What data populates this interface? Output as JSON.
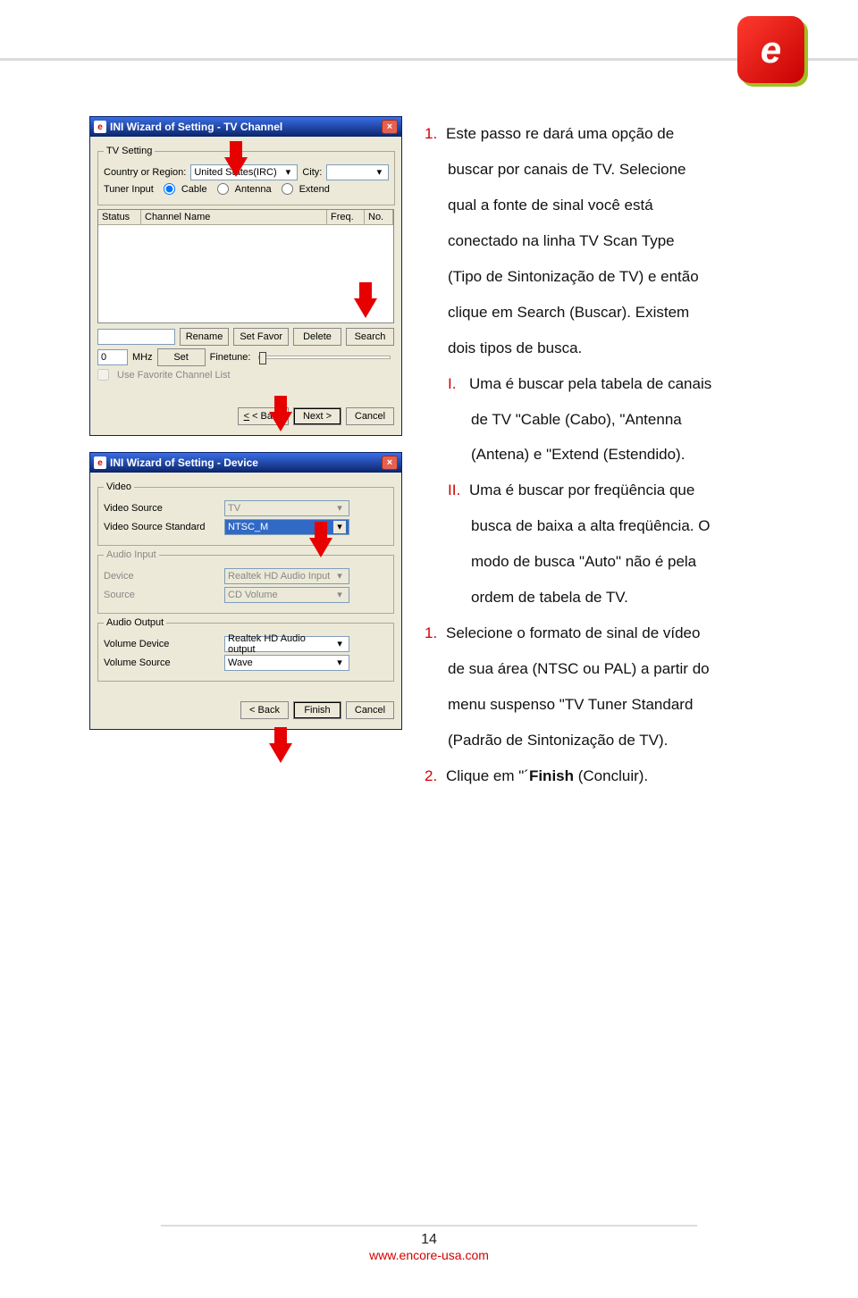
{
  "text": {
    "p1": "Este passo re dará uma opção de",
    "p2": "buscar por canais de TV. Selecione",
    "p3": "qual a fonte de sinal você está",
    "p4": "conectado na linha TV Scan Type",
    "p5": "(Tipo de Sintonização de TV) e então",
    "p6": "clique em Search (Buscar). Existem",
    "p7": "dois tipos de busca.",
    "i1": "Uma é buscar pela tabela de canais",
    "i2": "de TV \"Cable (Cabo), \"Antenna",
    "i3": "(Antena) e \"Extend (Estendido).",
    "ii1": "Uma é buscar por freqüência que",
    "ii2": "busca de baixa a alta freqüência. O",
    "ii3": "modo de busca \"Auto\" não é pela",
    "ii4": "ordem de tabela de TV.",
    "s1": "Selecione o formato de sinal de vídeo",
    "s2": "de sua área (NTSC ou PAL) a partir do",
    "s3": "menu suspenso \"TV Tuner Standard",
    "s4": "(Padrão de Sintonização de TV).",
    "f1": " (Concluir).",
    "f1a": "Clique em \"´",
    "f1b": "Finish"
  },
  "win1": {
    "title": "INI Wizard of Setting - TV Channel",
    "tvsetting": "TV Setting",
    "country": "Country or Region:",
    "country_val": "United States(IRC)",
    "city": "City:",
    "tuner": "Tuner Input",
    "r_cable": "Cable",
    "r_antenna": "Antenna",
    "r_extend": "Extend",
    "h_status": "Status",
    "h_name": "Channel Name",
    "h_freq": "Freq.",
    "h_no": "No.",
    "rename": "Rename",
    "setfavor": "Set Favor",
    "delete": "Delete",
    "search": "Search",
    "mhz": "MHz",
    "set": "Set",
    "finetune": "Finetune:",
    "favlist": "Use Favorite Channel List",
    "back": "< Back",
    "next": "Next >",
    "cancel": "Cancel",
    "freq0": "0"
  },
  "win2": {
    "title": "INI Wizard of Setting - Device",
    "video": "Video",
    "vsource": "Video Source",
    "vsource_val": "TV",
    "vstd": "Video Source Standard",
    "vstd_val": "NTSC_M",
    "audioin": "Audio Input",
    "device": "Device",
    "device_val": "Realtek HD Audio Input",
    "source": "Source",
    "source_val": "CD Volume",
    "audioout": "Audio Output",
    "voldev": "Volume Device",
    "voldev_val": "Realtek HD Audio output",
    "volsrc": "Volume Source",
    "volsrc_val": "Wave",
    "back": "< Back",
    "finish": "Finish",
    "cancel": "Cancel"
  },
  "page_number": "14",
  "footer": "www.encore-usa.com"
}
